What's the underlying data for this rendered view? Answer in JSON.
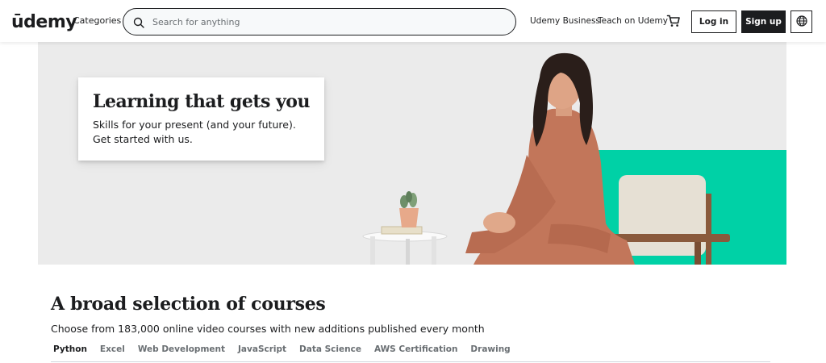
{
  "header": {
    "logo_text": "ūdemy",
    "categories_label": "Categories",
    "search": {
      "placeholder": "Search for anything",
      "value": ""
    },
    "nav_links": [
      "Udemy Business",
      "Teach on Udemy"
    ],
    "login_label": "Log in",
    "signup_label": "Sign up",
    "icons": {
      "search": "search-icon",
      "cart": "cart-icon",
      "language": "globe-icon"
    },
    "colors": {
      "brand": "#a435f0",
      "text": "#1c1d1f",
      "signup_bg": "#1c1d1f"
    }
  },
  "hero": {
    "title": "Learning that gets you",
    "subtitle": "Skills for your present (and your future). Get started with us.",
    "colors": {
      "background": "#ebebeb",
      "accent": "#00d1a6",
      "card": "#ffffff"
    }
  },
  "courses": {
    "title": "A broad selection of courses",
    "subtitle": "Choose from 183,000 online video courses with new additions published every month",
    "tabs": [
      {
        "label": "Python",
        "active": true
      },
      {
        "label": "Excel",
        "active": false
      },
      {
        "label": "Web Development",
        "active": false
      },
      {
        "label": "JavaScript",
        "active": false
      },
      {
        "label": "Data Science",
        "active": false
      },
      {
        "label": "AWS Certification",
        "active": false
      },
      {
        "label": "Drawing",
        "active": false
      }
    ]
  }
}
